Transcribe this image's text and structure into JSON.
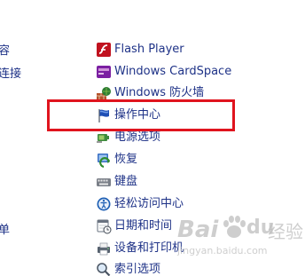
{
  "left_panel": {
    "items": [
      {
        "label": "容"
      },
      {
        "label": "连接"
      },
      {
        "label": "单"
      }
    ]
  },
  "control_panel": {
    "items": [
      {
        "label": "Flash Player",
        "icon": "flash-player-icon"
      },
      {
        "label": "Windows CardSpace",
        "icon": "cardspace-icon"
      },
      {
        "label": "Windows 防火墙",
        "icon": "firewall-icon"
      },
      {
        "label": "操作中心",
        "icon": "action-center-flag-icon"
      },
      {
        "label": "电源选项",
        "icon": "power-options-icon"
      },
      {
        "label": "恢复",
        "icon": "recovery-icon"
      },
      {
        "label": "键盘",
        "icon": "keyboard-icon"
      },
      {
        "label": "轻松访问中心",
        "icon": "ease-of-access-icon"
      },
      {
        "label": "日期和时间",
        "icon": "date-time-icon"
      },
      {
        "label": "设备和打印机",
        "icon": "devices-printers-icon"
      },
      {
        "label": "索引选项",
        "icon": "indexing-options-icon"
      }
    ]
  },
  "watermark": {
    "brand": "Bai",
    "brand_du": "du",
    "suffix": "经验",
    "url": "jingyan.baidu.com"
  }
}
